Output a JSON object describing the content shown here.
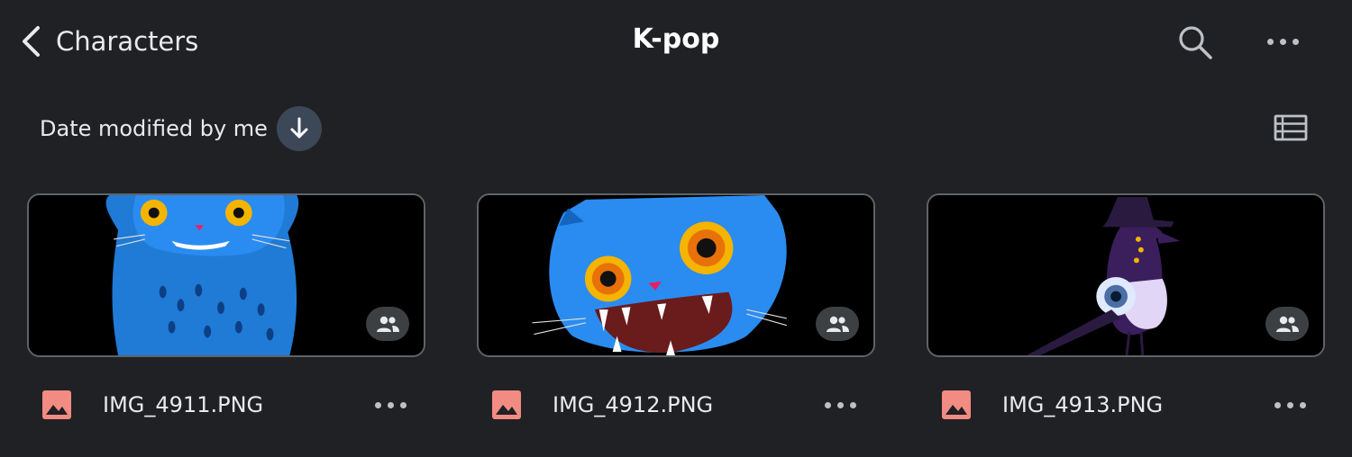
{
  "header": {
    "back_label": "Characters",
    "title": "K-pop",
    "back_icon": "chevron-left-icon",
    "search_icon": "search-icon",
    "more_icon": "more-horizontal-icon"
  },
  "sort": {
    "label": "Date modified by me",
    "direction_icon": "arrow-down-icon",
    "view_icon": "list-view-icon"
  },
  "files": [
    {
      "name": "IMG_4911.PNG",
      "type_icon": "image-file-icon",
      "shared_icon": "shared-people-icon"
    },
    {
      "name": "IMG_4912.PNG",
      "type_icon": "image-file-icon",
      "shared_icon": "shared-people-icon"
    },
    {
      "name": "IMG_4913.PNG",
      "type_icon": "image-file-icon",
      "shared_icon": "shared-people-icon"
    }
  ],
  "colors": {
    "background": "#202124",
    "text": "#e8eaed",
    "sort_button_bg": "#3c4758",
    "image_icon": "#f28b82",
    "card_border": "#5f6368"
  }
}
